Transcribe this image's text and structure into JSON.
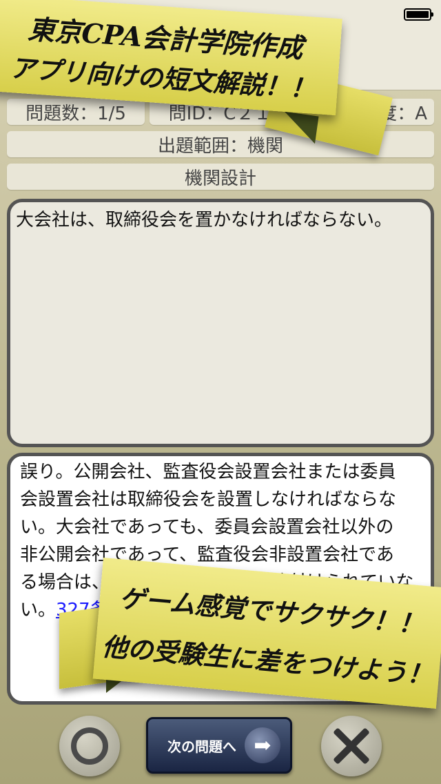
{
  "status": {
    "battery_icon": "battery-icon"
  },
  "info": {
    "question_count": "問題数：1/5",
    "question_id": "問ID：C２１",
    "difficulty": "重要度：A",
    "scope": "出題範囲：機関",
    "topic": "機関設計"
  },
  "question": {
    "text": "大会社は、取締役会を置かなければならない。"
  },
  "answer": {
    "lines": [
      "誤り。公開会社、監査役会設置会社または委員",
      "会設置会社は取締役会を設置しなければならな",
      "い。大会社であっても、委員会設置会社以外の",
      "非公開会社であって、監査役会非設置会社であ",
      "る場合は、取締役会の設置が義務付けられていな"
    ],
    "last_prefix": "い。",
    "link_text": "327条"
  },
  "banner_top": {
    "line1": "東京CPA会計学院作成",
    "line2": "アプリ向けの短文解説！！"
  },
  "banner_bottom": {
    "line1": "ゲーム感覚でサクサク！！",
    "line2": "他の受験生に差をつけよう！"
  },
  "buttons": {
    "correct_icon": "circle-icon",
    "next_label": "次の問題へ",
    "next_icon": "arrow-right-icon",
    "wrong_icon": "cross-icon"
  },
  "colors": {
    "banner": "#e8e06a",
    "next_button": "#1f2a48",
    "box_border": "#545454"
  }
}
